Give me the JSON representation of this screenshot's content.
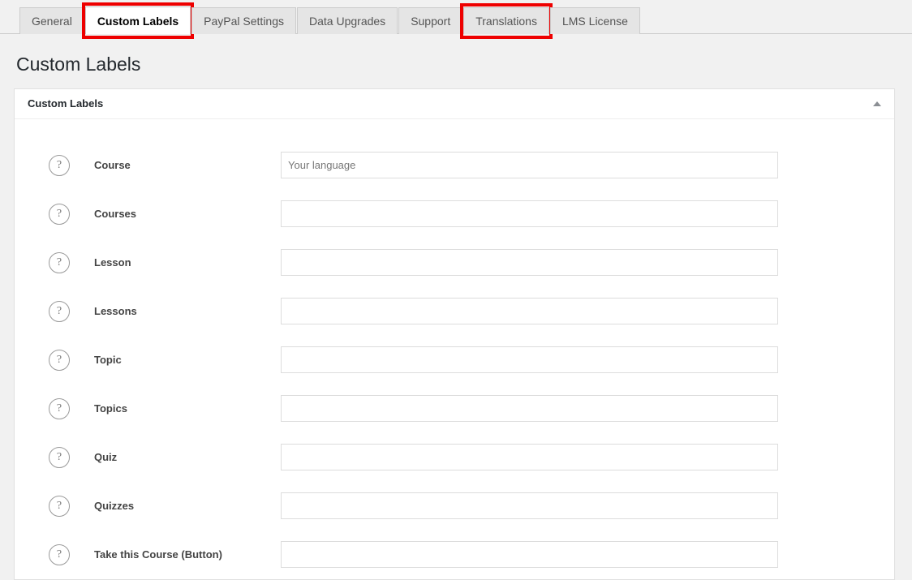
{
  "tabs": [
    {
      "label": "General",
      "active": false,
      "annotated": false
    },
    {
      "label": "Custom Labels",
      "active": true,
      "annotated": true
    },
    {
      "label": "PayPal Settings",
      "active": false,
      "annotated": false
    },
    {
      "label": "Data Upgrades",
      "active": false,
      "annotated": false
    },
    {
      "label": "Support",
      "active": false,
      "annotated": false
    },
    {
      "label": "Translations",
      "active": false,
      "annotated": true
    },
    {
      "label": "LMS License",
      "active": false,
      "annotated": false
    }
  ],
  "page": {
    "title": "Custom Labels"
  },
  "panel": {
    "title": "Custom Labels",
    "toggle_icon": "chevron-up-icon"
  },
  "form": {
    "help_icon": "question-mark-icon",
    "rows": [
      {
        "label": "Course",
        "value": "",
        "placeholder": "Your language"
      },
      {
        "label": "Courses",
        "value": "",
        "placeholder": ""
      },
      {
        "label": "Lesson",
        "value": "",
        "placeholder": ""
      },
      {
        "label": "Lessons",
        "value": "",
        "placeholder": ""
      },
      {
        "label": "Topic",
        "value": "",
        "placeholder": ""
      },
      {
        "label": "Topics",
        "value": "",
        "placeholder": ""
      },
      {
        "label": "Quiz",
        "value": "",
        "placeholder": ""
      },
      {
        "label": "Quizzes",
        "value": "",
        "placeholder": ""
      },
      {
        "label": "Take this Course (Button)",
        "value": "",
        "placeholder": ""
      }
    ]
  },
  "colors": {
    "page_background": "#f1f1f1",
    "annotation_red": "#ee0000",
    "panel_background": "#ffffff",
    "tab_inactive_background": "#e5e5e5"
  }
}
